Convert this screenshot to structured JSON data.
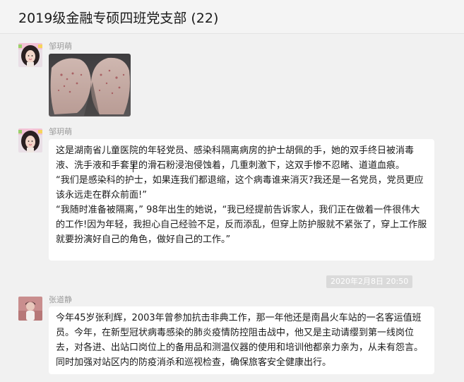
{
  "header": {
    "title": "2019级金融专硕四班党支部 (22)"
  },
  "messages": [
    {
      "sender": "邹玥萌",
      "type": "image",
      "image_icon": "hands-photo"
    },
    {
      "sender": "邹玥萌",
      "type": "text",
      "text": "这是湖南省儿童医院的年轻党员、感染科隔离病房的护士胡佩的手，她的双手终日被消毒液、洗手液和手套里的滑石粉浸泡侵蚀着，几重刺激下，这双手惨不忍睹、道道血痕。\n“我们是感染科的护士，如果连我们都退缩，这个病毒谁来消灭?我还是一名党员，党员更应该永远走在群众前面!”\n“我随时准备被隔离，” 98年出生的她说，“我已经提前告诉家人，我们正在做着一件很伟大的工作!因为年轻，我担心自己经验不足，反而添乱，但穿上防护服就不紧张了，穿上工作服就要扮演好自己的角色，做好自己的工作。”"
    },
    {
      "sender": "张道静",
      "type": "text",
      "text": "今年45岁张利辉，2003年曾参加抗击非典工作，那一年他还是南昌火车站的一名客运值班员。今年，在新型冠状病毒感染的肺炎疫情防控阻击战中，他又是主动请缨到第一线岗位去，对各进、出站口岗位上的备用品和测温仪器的使用和培训他都亲力亲为，从未有怨言。同时加强对站区内的防疫消杀和巡视检查，确保旅客安全健康出行。"
    }
  ],
  "timestamp": "2020年2月8日 20:50",
  "colors": {
    "background": "#f1f1f1",
    "bubble": "#ffffff",
    "timestamp_bg": "#dadada",
    "sender_name": "#9a9a9a"
  }
}
